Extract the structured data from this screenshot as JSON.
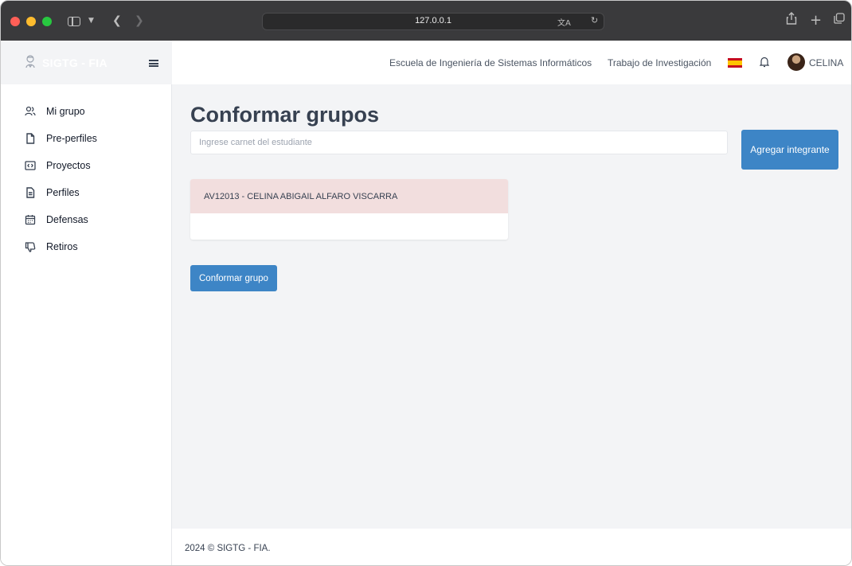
{
  "browser": {
    "url": "127.0.0.1"
  },
  "sidebar": {
    "brand": "SIGTG - FIA",
    "items": [
      {
        "label": "Mi grupo",
        "icon": "users-icon"
      },
      {
        "label": "Pre-perfiles",
        "icon": "file-icon"
      },
      {
        "label": "Proyectos",
        "icon": "code-window-icon"
      },
      {
        "label": "Perfiles",
        "icon": "document-icon"
      },
      {
        "label": "Defensas",
        "icon": "calendar-icon"
      },
      {
        "label": "Retiros",
        "icon": "thumbs-down-icon"
      }
    ]
  },
  "topbar": {
    "school": "Escuela de Ingeniería de Sistemas Informáticos",
    "work": "Trabajo de Investigación",
    "user": "CELINA"
  },
  "main": {
    "title": "Conformar grupos",
    "search_placeholder": "Ingrese carnet del estudiante",
    "add_button": "Agregar integrante",
    "member": "AV12013 - CELINA ABIGAIL ALFARO VISCARRA",
    "confirm_button": "Conformar grupo"
  },
  "footer": {
    "text": "2024 © SIGTG - FIA."
  },
  "colors": {
    "primary": "#3d85c6",
    "member_highlight": "#f2dede",
    "page_bg": "#f3f4f6"
  }
}
